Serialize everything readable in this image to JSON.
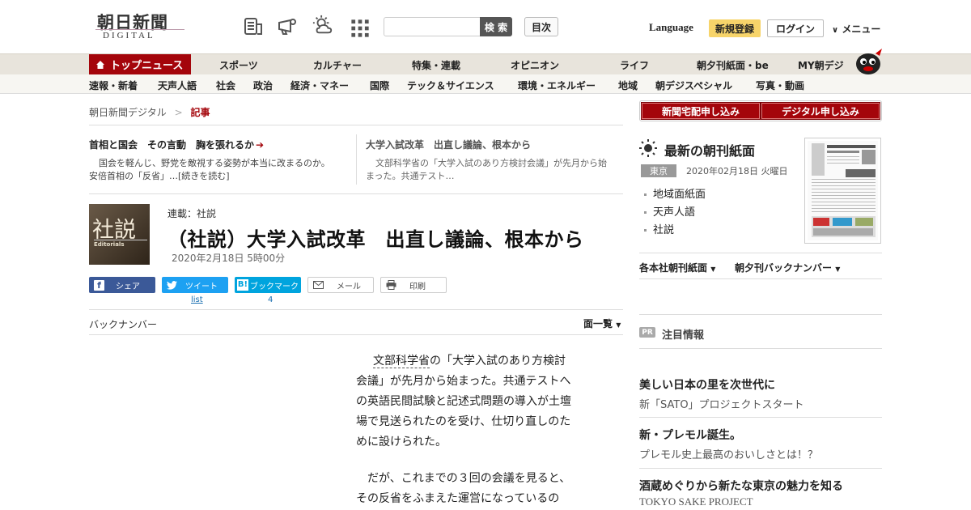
{
  "header": {
    "logo_main": "朝日新聞",
    "logo_sub": "DIGITAL",
    "search_button": "検 索",
    "search_placeholder": "",
    "toc_button": "目次",
    "language": "Language",
    "register": "新規登録",
    "login": "ログイン",
    "menu": "メニュー"
  },
  "nav_primary": [
    "トップニュース",
    "スポーツ",
    "カルチャー",
    "特集・連載",
    "オピニオン",
    "ライフ",
    "朝夕刊紙面・be",
    "MY朝デジ"
  ],
  "nav_secondary": [
    "速報・新着",
    "天声人語",
    "社会",
    "政治",
    "経済・マネー",
    "国際",
    "テック＆サイエンス",
    "環境・エネルギー",
    "地域",
    "朝デジスペシャル",
    "写真・動画"
  ],
  "breadcrumb": {
    "home": "朝日新聞デジタル",
    "sep": ">",
    "current": "記事"
  },
  "promos": [
    {
      "title": "首相と国会　その言動　胸を張れるか",
      "desc": "国会を軽んじ、野党を敵視する姿勢が本当に改まるのか。安倍首相の「反省」…[続きを読む]"
    },
    {
      "title": "大学入試改革　出直し議論、根本から",
      "desc": "文部科学省の「大学入試のあり方検討会議」が先月から始まった。共通テスト…"
    }
  ],
  "article": {
    "kanji": "社説",
    "kanji_sub": "Editorials",
    "series": "連載：社説",
    "title": "（社説）大学入試改革　出直し議論、根本から",
    "date": "2020年2月18日 5時00分",
    "back_number": "バックナンバー",
    "page_list": "面一覧",
    "paragraphs": [
      [
        "文部科学省",
        "の「大学入試のあり方検討",
        "会議」が先月から始まった。共通テストへ",
        "の英語民間試験と記述式問題の導入が土壇",
        "場で見送られたのを受け、仕切り直しのた",
        "めに設けられた。"
      ],
      [
        "だが、これまでの３回の会議を見ると、",
        "その反省をふまえた運営になっているの"
      ]
    ]
  },
  "share": {
    "facebook": "シェア",
    "twitter": "ツイート",
    "twitter_count": "list",
    "hatena": "ブックマーク",
    "hatena_count": "4",
    "mail": "メール",
    "print": "印刷"
  },
  "sidebar": {
    "btn_delivery": "新聞宅配申し込み",
    "btn_digital": "デジタル申し込み",
    "latest_title": "最新の朝刊紙面",
    "region": "東京",
    "paper_date": "2020年02月18日 火曜日",
    "links": [
      "地域面紙面",
      "天声人語",
      "社説"
    ],
    "dropdown1": "各本社朝刊紙面",
    "dropdown2": "朝夕刊バックナンバー",
    "pr_badge": "PR",
    "pr_title": "注目情報",
    "ads": [
      {
        "title": "美しい日本の里を次世代に",
        "desc": "新「SATO」プロジェクトスタート"
      },
      {
        "title": "新・プレモル誕生。",
        "desc": "プレモル史上最高のおいしさとは！？"
      },
      {
        "title": "酒蔵めぐりから新たな東京の魅力を知る",
        "desc": "TOKYO SAKE PROJECT"
      }
    ]
  },
  "colors": {
    "brand_red": "#a4050b",
    "register_yellow": "#f7d46a",
    "facebook": "#3b5998",
    "twitter": "#1da1f2",
    "hatena": "#00a4de"
  }
}
